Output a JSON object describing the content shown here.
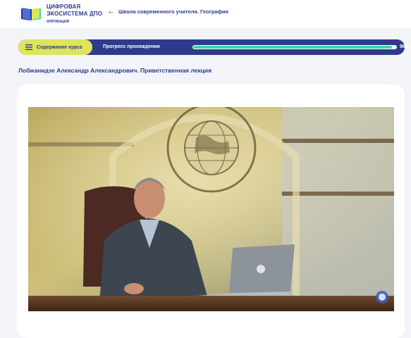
{
  "header": {
    "logo": {
      "line1": "ЦИФРОВАЯ",
      "line2": "ЭКОСИСТЕМА ДПО",
      "sub": "АПРОБАЦИЯ"
    },
    "back_arrow": "←",
    "back_label": "Школа современного учителя. География"
  },
  "course_bar": {
    "contents_label": "Содержание курса",
    "progress_label": "Прогресс прохождения",
    "progress_value": "98%",
    "progress_fraction": 0.98
  },
  "lecture": {
    "title": "Лобжанидзе Александр Александрович. Приветственная лекция"
  },
  "video": {
    "emblem_text_top": "РУССКОЕ ГЕОГРАФИЧЕСКОЕ ОБЩЕСТВО",
    "emblem_text_bottom": "ОСНОВАНО В 1845 г."
  },
  "colors": {
    "brand": "#2e3b8c",
    "accent": "#dfe45c",
    "progress": "#3dd6a8"
  }
}
